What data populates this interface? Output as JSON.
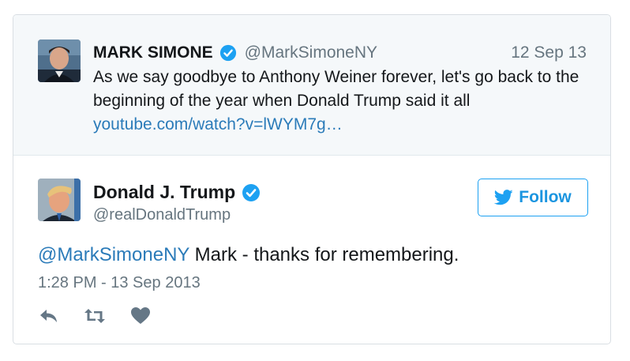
{
  "quoted_tweet": {
    "name": "MARK SIMONE",
    "handle": "@MarkSimoneNY",
    "date": "12 Sep 13",
    "text_line1": "As we say goodbye to Anthony Weiner forever, let's go back to the",
    "text_line2": "beginning of the year when Donald Trump said it all",
    "link": "youtube.com/watch?v=lWYM7g…",
    "verified_icon": "verified-badge-icon"
  },
  "tweet": {
    "name": "Donald J. Trump",
    "handle": "@realDonaldTrump",
    "mention": "@MarkSimoneNY",
    "text": " Mark - thanks for remembering.",
    "timestamp": "1:28 PM - 13 Sep 2013",
    "follow_label": "Follow",
    "verified_icon": "verified-badge-icon"
  },
  "actions": {
    "icons": [
      "reply-icon",
      "retweet-icon",
      "like-icon"
    ]
  },
  "colors": {
    "link": "#2b7bb9",
    "brand": "#1da1f2",
    "secondary_text": "#66757f",
    "quoted_bg": "#f5f8fa",
    "action_icon": "#657786"
  }
}
